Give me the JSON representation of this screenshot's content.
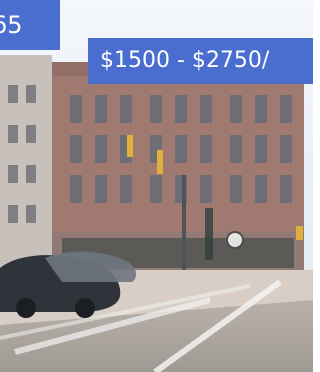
{
  "listing": {
    "badge_number": "65",
    "price_range": "$1500 - $2750/",
    "photo": {
      "subject": "photo",
      "colors": {
        "sky": "#dfe7f1",
        "brick": "#a07a70",
        "sidewalk": "#d8cec6",
        "road": "#9a9a9a",
        "car": "#2f343b"
      }
    }
  }
}
